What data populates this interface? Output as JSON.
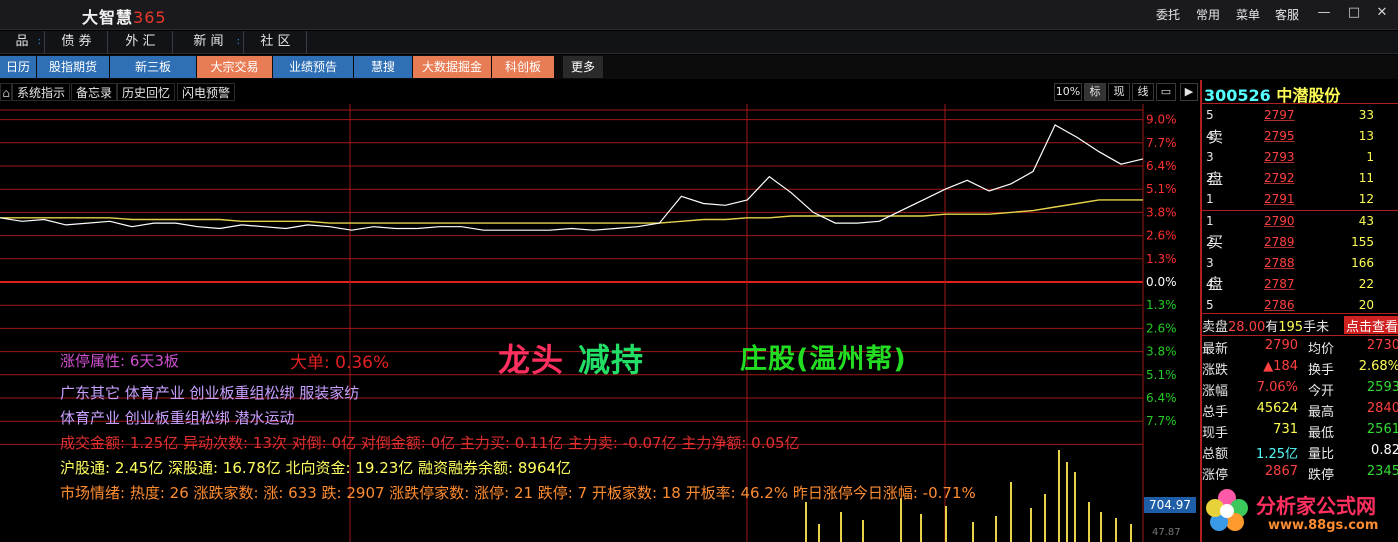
{
  "app": {
    "name": "大智慧",
    "version": "365"
  },
  "title_menu": [
    "委托",
    "常用",
    "菜单",
    "客服"
  ],
  "window_buttons": [
    "—",
    "□",
    "✕"
  ],
  "nav1": [
    {
      "label": "品",
      "dots": ":"
    },
    {
      "label": "债 券",
      "dots": ""
    },
    {
      "label": "外 汇",
      "dots": ""
    },
    {
      "label": "新 闻",
      "dots": ":"
    },
    {
      "label": "社 区",
      "dots": ""
    }
  ],
  "nav2": [
    {
      "label": "日历",
      "style": "blue"
    },
    {
      "label": "股指期货",
      "style": "blue"
    },
    {
      "label": "新三板",
      "style": "blue"
    },
    {
      "label": "大宗交易",
      "style": "orange"
    },
    {
      "label": "业绩预告",
      "style": "blue"
    },
    {
      "label": "慧搜",
      "style": "blue"
    },
    {
      "label": "大数据掘金",
      "style": "orange"
    },
    {
      "label": "科创板",
      "style": "orange"
    },
    {
      "label": "更多",
      "style": "grey"
    }
  ],
  "toolbar": {
    "buttons": [
      "系统指示",
      "备忘录",
      "历史回忆",
      "闪电预警"
    ],
    "right": [
      "10%",
      "标",
      "现",
      "线"
    ]
  },
  "chart_data": {
    "type": "line",
    "yticks_up": [
      "9.0%",
      "7.7%",
      "6.4%",
      "5.1%",
      "3.8%",
      "2.6%",
      "1.3%"
    ],
    "ytick_zero": "0.0%",
    "yticks_down": [
      "1.3%",
      "2.6%",
      "3.8%",
      "5.1%",
      "6.4%",
      "7.7%"
    ],
    "ylim": [
      -9.0,
      9.0
    ],
    "price_line": [
      3.6,
      3.4,
      3.5,
      3.2,
      3.3,
      3.4,
      3.1,
      3.3,
      3.3,
      3.1,
      3.0,
      3.2,
      3.1,
      3.0,
      3.2,
      3.1,
      2.9,
      3.1,
      3.0,
      3.0,
      3.1,
      3.1,
      2.9,
      2.9,
      2.9,
      2.9,
      3.0,
      2.9,
      3.0,
      3.1,
      3.3,
      4.8,
      4.4,
      4.3,
      4.6,
      5.9,
      5.0,
      3.9,
      3.3,
      3.3,
      3.4,
      4.0,
      4.6,
      5.2,
      5.7,
      5.1,
      5.5,
      6.2,
      8.8,
      8.1,
      7.3,
      6.6,
      6.9
    ],
    "avg_line": [
      3.6,
      3.6,
      3.6,
      3.6,
      3.6,
      3.6,
      3.5,
      3.5,
      3.5,
      3.5,
      3.5,
      3.4,
      3.4,
      3.4,
      3.4,
      3.3,
      3.3,
      3.3,
      3.3,
      3.3,
      3.3,
      3.3,
      3.3,
      3.3,
      3.3,
      3.3,
      3.3,
      3.3,
      3.3,
      3.3,
      3.3,
      3.4,
      3.5,
      3.5,
      3.6,
      3.6,
      3.7,
      3.7,
      3.7,
      3.7,
      3.7,
      3.7,
      3.7,
      3.8,
      3.8,
      3.8,
      3.9,
      4.0,
      4.2,
      4.4,
      4.6,
      4.6,
      4.6
    ],
    "volume_value": "704.97",
    "volume_label": "47.87"
  },
  "overlay": {
    "limit_attr": "涨停属性:  6天3板",
    "big_order": "大单:  0.36%",
    "big_title_1": "龙头",
    "big_title_2": "减持",
    "big_title_3": "庄股(温州帮)",
    "concepts_1": "广东其它  体育产业  创业板重组松绑  服装家纺",
    "concepts_2": "体育产业  创业板重组松绑  潜水运动",
    "flow": "成交金额:  1.25亿  异动次数:  13次  对倒:  0亿  对倒金额:  0亿  主力买:  0.11亿  主力卖:  -0.07亿  主力净额:  0.05亿",
    "north": "沪股通:  2.45亿  深股通:  16.78亿  北向资金:  19.23亿  融资融券余额:  8964亿",
    "market": "市场情绪:    热度:  26  涨跌家数:  涨:  633  跌:  2907  涨跌停家数:  涨停:  21  跌停:  7  开板家数:  18  开板率:  46.2%  昨日涨停今日涨幅:  -0.71%"
  },
  "quote": {
    "code": "300526",
    "name": "中潜股份",
    "sell_label": [
      "卖",
      "盘"
    ],
    "buy_label": [
      "买",
      "盘"
    ],
    "asks": [
      {
        "level": "5",
        "price": "2797",
        "vol": "33"
      },
      {
        "level": "4",
        "price": "2795",
        "vol": "13"
      },
      {
        "level": "3",
        "price": "2793",
        "vol": "1"
      },
      {
        "level": "2",
        "price": "2792",
        "vol": "11"
      },
      {
        "level": "1",
        "price": "2791",
        "vol": "12"
      }
    ],
    "bids": [
      {
        "level": "1",
        "price": "2790",
        "vol": "43"
      },
      {
        "level": "2",
        "price": "2789",
        "vol": "155"
      },
      {
        "level": "3",
        "price": "2788",
        "vol": "166"
      },
      {
        "level": "4",
        "price": "2787",
        "vol": "22"
      },
      {
        "level": "5",
        "price": "2786",
        "vol": "20"
      }
    ],
    "sell_info": {
      "prefix": "卖盘",
      "val": "28.00",
      "mid": "有",
      "num": "195",
      "suffix": "手未",
      "link": "点击查看"
    },
    "stats": [
      {
        "k1": "最新",
        "v1": "2790",
        "c1": "#ff4040",
        "k2": "均价",
        "v2": "2730",
        "c2": "#ff4040"
      },
      {
        "k1": "涨跌",
        "v1": "▲184",
        "c1": "#ff4040",
        "k2": "换手",
        "v2": "2.68%",
        "c2": "#ffff55"
      },
      {
        "k1": "涨幅",
        "v1": "7.06%",
        "c1": "#ff4040",
        "k2": "今开",
        "v2": "2593",
        "c2": "#33dd33"
      },
      {
        "k1": "总手",
        "v1": "45624",
        "c1": "#ffff55",
        "k2": "最高",
        "v2": "2840",
        "c2": "#ff4040"
      },
      {
        "k1": "现手",
        "v1": "731",
        "c1": "#ffff55",
        "k2": "最低",
        "v2": "2561",
        "c2": "#33dd33"
      },
      {
        "k1": "总额",
        "v1": "1.25亿",
        "c1": "#55ffff",
        "k2": "量比",
        "v2": "0.82",
        "c2": "#ffffff"
      },
      {
        "k1": "涨停",
        "v1": "2867",
        "c1": "#ff4040",
        "k2": "跌停",
        "v2": "2345",
        "c2": "#33dd33"
      }
    ]
  },
  "watermark": {
    "title": "分析家公式网",
    "url": "www.88gs.com"
  }
}
